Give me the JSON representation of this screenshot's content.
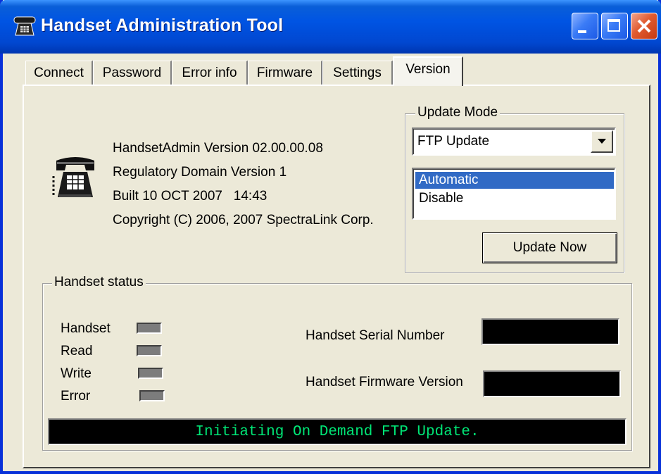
{
  "window": {
    "title": "Handset Administration Tool",
    "title_icon": "phone-icon",
    "controls": [
      "minimize-icon",
      "maximize-icon",
      "close-icon"
    ]
  },
  "tabs": [
    {
      "label": "Connect",
      "active": false
    },
    {
      "label": "Password",
      "active": false
    },
    {
      "label": "Error info",
      "active": false
    },
    {
      "label": "Firmware",
      "active": false
    },
    {
      "label": "Settings",
      "active": false
    },
    {
      "label": "Version",
      "active": true
    }
  ],
  "version_info": {
    "icon": "telephone-icon",
    "lines": [
      "HandsetAdmin Version 02.00.00.08",
      "Regulatory Domain Version 1",
      "Built 10 OCT 2007   14:43",
      "Copyright (C) 2006, 2007 SpectraLink Corp."
    ]
  },
  "update_mode": {
    "legend": "Update Mode",
    "selected": "FTP Update",
    "options": [
      {
        "label": "Automatic",
        "selected": true
      },
      {
        "label": "Disable",
        "selected": false
      }
    ],
    "button_label": "Update Now"
  },
  "handset_status": {
    "legend": "Handset status",
    "indicators": [
      {
        "label": "Handset"
      },
      {
        "label": "Read"
      },
      {
        "label": "Write"
      },
      {
        "label": "Error"
      }
    ],
    "serial_number_label": "Handset Serial Number",
    "serial_number_value": "",
    "firmware_version_label": "Handset Firmware Version",
    "firmware_version_value": "",
    "message": "Initiating On Demand FTP Update."
  },
  "colors": {
    "titlebar": "#0054e3",
    "selection": "#316ac5",
    "status_text": "#00e676",
    "led_off": "#7c7c7c"
  }
}
